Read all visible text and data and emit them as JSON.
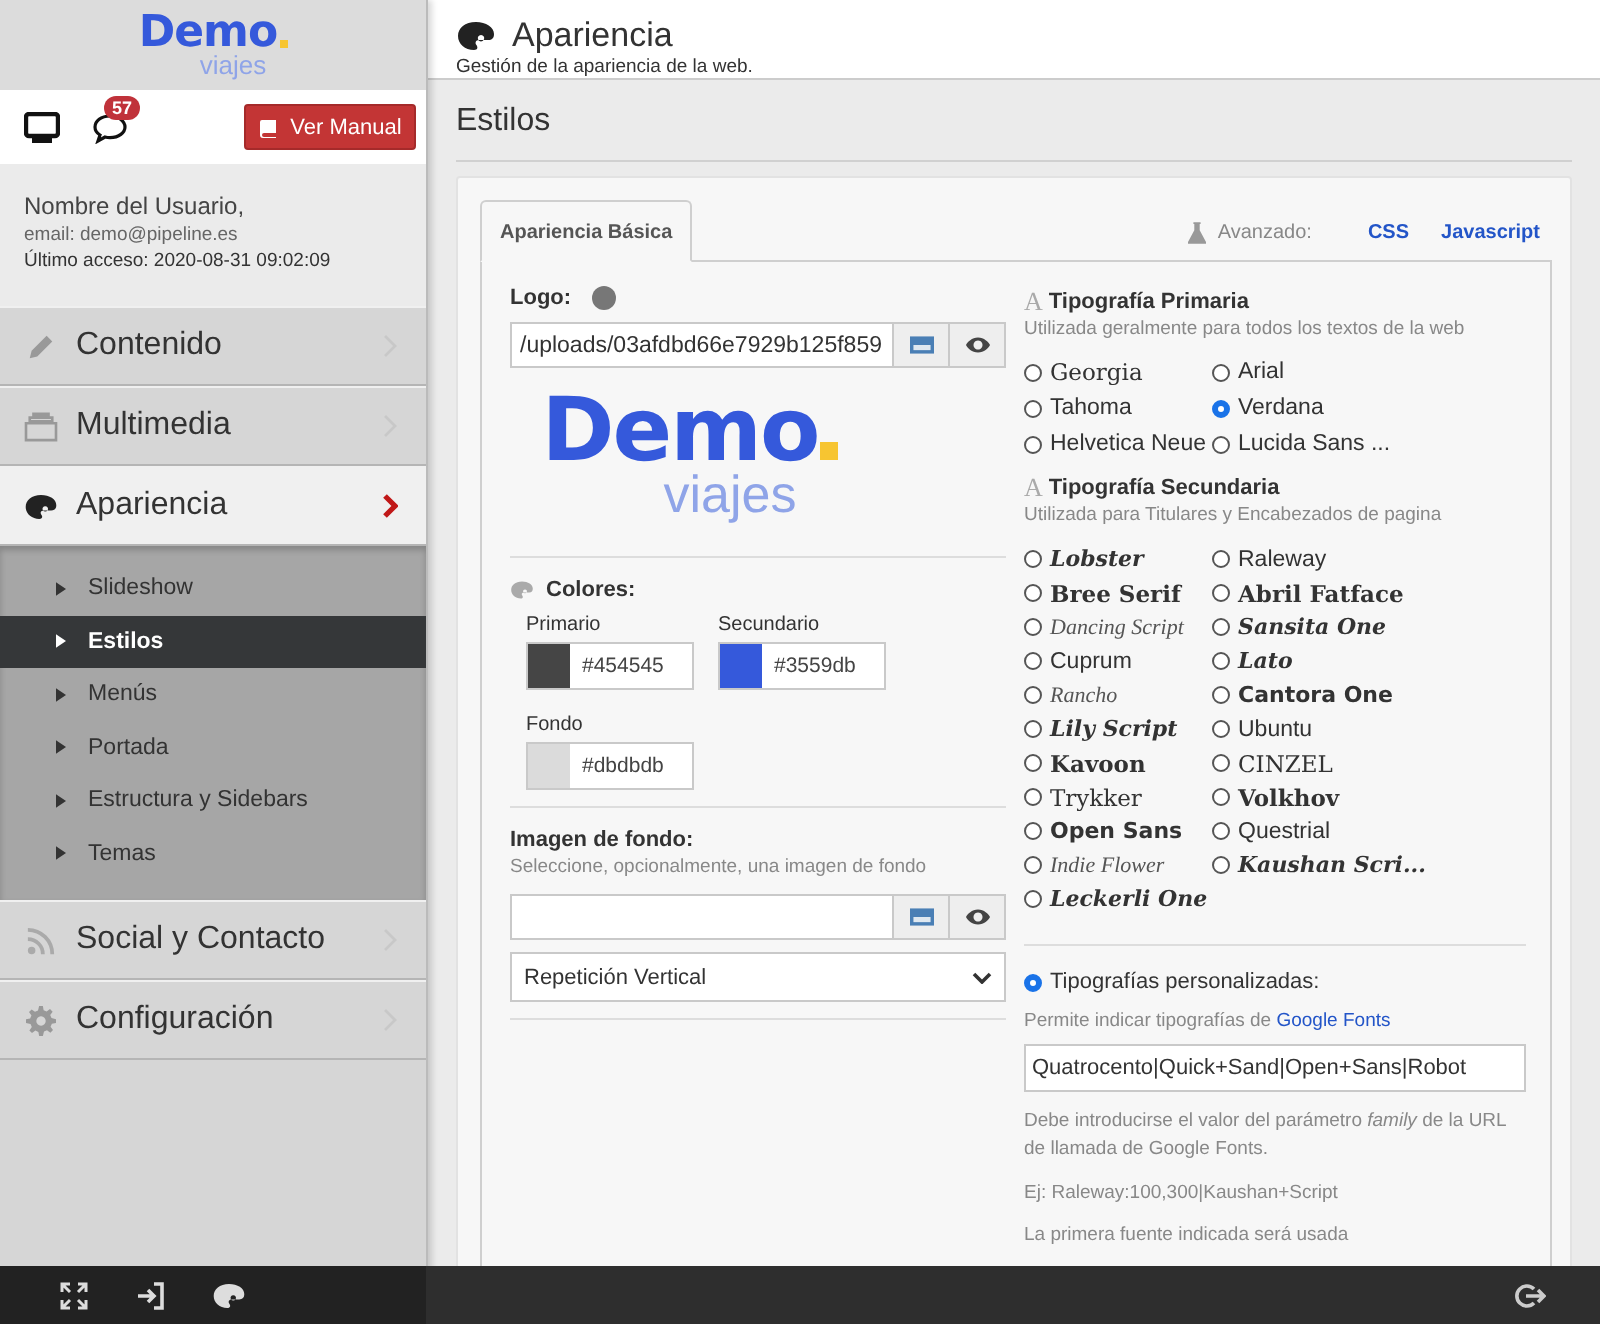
{
  "sidebar": {
    "logo": {
      "word": "Demo",
      "sub": "viajes"
    },
    "notifications": {
      "count": "57"
    },
    "manual_button": "Ver Manual",
    "user": {
      "name": "Nombre del Usuario,",
      "email": "email: demo@pipeline.es",
      "last_access": "Último acceso: 2020-08-31 09:02:09"
    },
    "menu": [
      {
        "label": "Contenido",
        "expanded": false
      },
      {
        "label": "Multimedia",
        "expanded": false
      },
      {
        "label": "Apariencia",
        "expanded": true,
        "children": [
          {
            "label": "Slideshow",
            "selected": false
          },
          {
            "label": "Estilos",
            "selected": true
          },
          {
            "label": "Menús",
            "selected": false
          },
          {
            "label": "Portada",
            "selected": false
          },
          {
            "label": "Estructura y Sidebars",
            "selected": false
          },
          {
            "label": "Temas",
            "selected": false
          }
        ]
      },
      {
        "label": "Social y Contacto",
        "expanded": false
      },
      {
        "label": "Configuración",
        "expanded": false
      }
    ]
  },
  "header": {
    "title": "Apariencia",
    "subtitle": "Gestión de la apariencia de la web."
  },
  "section_title": "Estilos",
  "tabs": [
    {
      "label": "Apariencia Básica",
      "selected": true
    }
  ],
  "advanced": {
    "label": "Avanzado:",
    "links": [
      "CSS",
      "Javascript"
    ]
  },
  "logo_field": {
    "label": "Logo:",
    "value": "/uploads/03afdbd66e7929b125f859",
    "preview": {
      "word": "Demo",
      "sub": "viajes"
    }
  },
  "colors": {
    "label": "Colores:",
    "items": [
      {
        "label": "Primario",
        "value": "#454545",
        "color": "#454545"
      },
      {
        "label": "Secundario",
        "value": "#3559db",
        "color": "#3559db"
      },
      {
        "label": "Fondo",
        "value": "#dbdbdb",
        "color": "#dbdbdb"
      }
    ]
  },
  "background_image": {
    "label": "Imagen de fondo:",
    "hint": "Seleccione, opcionalmente, una imagen de fondo",
    "repeat": "Repetición Vertical"
  },
  "primary_typography": {
    "icon": "A",
    "title": "Tipografía Primaria",
    "hint": "Utilizada geralmente para todos los textos de la web",
    "options": [
      {
        "label": "Georgia",
        "selected": false,
        "kind": "serif"
      },
      {
        "label": "Arial",
        "selected": false,
        "kind": "sans"
      },
      {
        "label": "Tahoma",
        "selected": false,
        "kind": "sans"
      },
      {
        "label": "Verdana",
        "selected": true,
        "kind": "sans"
      },
      {
        "label": "Helvetica Neue",
        "selected": false,
        "kind": "sans"
      },
      {
        "label": "Lucida Sans ...",
        "selected": false,
        "kind": "sans"
      }
    ]
  },
  "secondary_typography": {
    "icon": "A",
    "title": "Tipografía Secundaria",
    "hint": "Utilizada para Titulares y Encabezados de pagina",
    "options": [
      {
        "label": "Lobster",
        "selected": false,
        "kind": "script"
      },
      {
        "label": "Raleway",
        "selected": false,
        "kind": "sans"
      },
      {
        "label": "Bree Serif",
        "selected": false,
        "kind": "bold-serif"
      },
      {
        "label": "Abril Fatface",
        "selected": false,
        "kind": "bold-serif"
      },
      {
        "label": "Dancing Script",
        "selected": false,
        "kind": "light-script"
      },
      {
        "label": "Sansita One",
        "selected": false,
        "kind": "script"
      },
      {
        "label": "Cuprum",
        "selected": false,
        "kind": "narrow"
      },
      {
        "label": "Lato",
        "selected": false,
        "kind": "script"
      },
      {
        "label": "Rancho",
        "selected": false,
        "kind": "light-script"
      },
      {
        "label": "Cantora One",
        "selected": false,
        "kind": "bold-sans"
      },
      {
        "label": "Lily Script",
        "selected": false,
        "kind": "script"
      },
      {
        "label": "Ubuntu",
        "selected": false,
        "kind": "sans"
      },
      {
        "label": "Kavoon",
        "selected": false,
        "kind": "bold-serif"
      },
      {
        "label": "CINZEL",
        "selected": false,
        "kind": "serif"
      },
      {
        "label": "Trykker",
        "selected": false,
        "kind": "serif"
      },
      {
        "label": "Volkhov",
        "selected": false,
        "kind": "bold-serif"
      },
      {
        "label": "Open Sans",
        "selected": false,
        "kind": "bold-sans"
      },
      {
        "label": "Questrial",
        "selected": false,
        "kind": "sans"
      },
      {
        "label": "Indie Flower",
        "selected": false,
        "kind": "light-script"
      },
      {
        "label": "Kaushan Scri...",
        "selected": false,
        "kind": "script"
      },
      {
        "label": "Leckerli One",
        "selected": false,
        "kind": "script"
      }
    ]
  },
  "custom_typography": {
    "label": "Tipografías personalizadas:",
    "selected": true,
    "hint": "Permite indicar tipografías de",
    "link": "Google Fonts",
    "value": "Quatrocento|Quick+Sand|Open+Sans|Robot",
    "help": [
      "Debe introducirse el valor del parámetro *family* de la URL de llamada de Google Fonts.",
      "Ej: Raleway:100,300|Kaushan+Script",
      "La primera fuente indicada será usada"
    ]
  }
}
